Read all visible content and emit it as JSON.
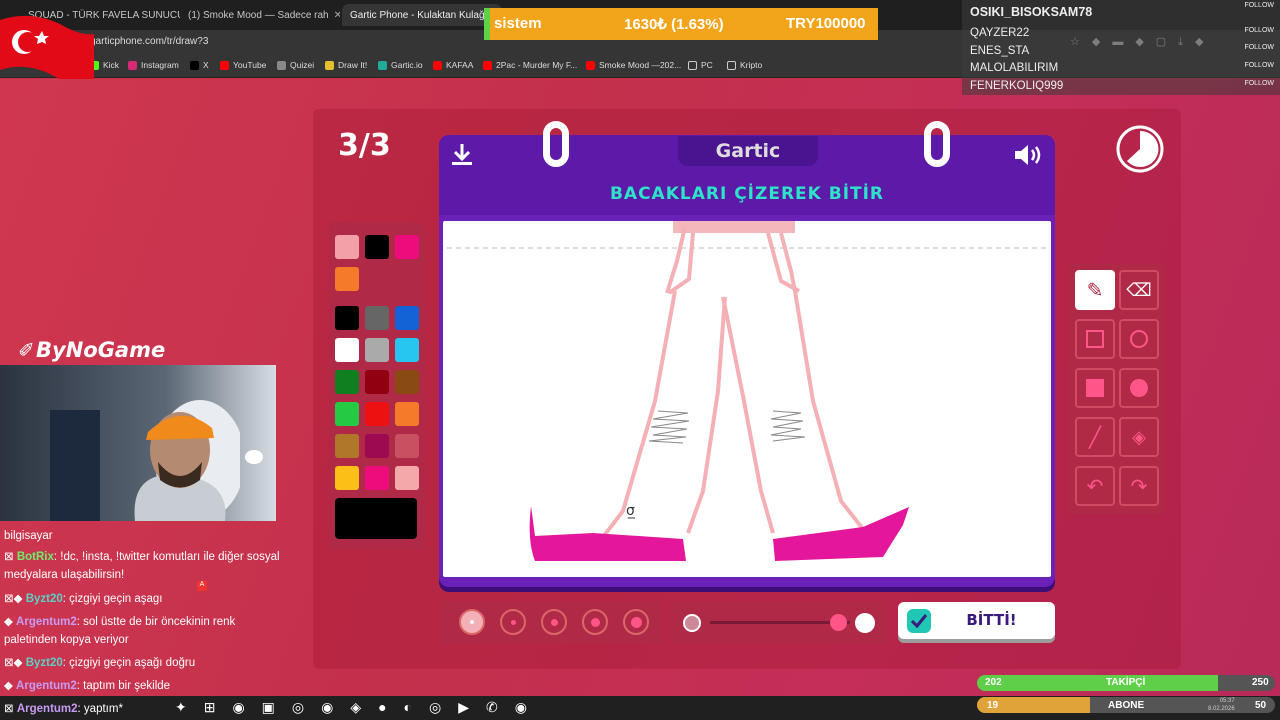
{
  "browser": {
    "tabs": [
      {
        "label": "SQUAD - TÜRK FAVELA SUNUCU"
      },
      {
        "label": "(1) Smoke Mood — Sadece rah"
      },
      {
        "label": "Gartic Phone - Kulaktan Kulağa"
      }
    ],
    "url": "garticphone.com/tr/draw?3",
    "bookmarks": [
      "Kick",
      "Instagram",
      "X",
      "YouTube",
      "Quizei",
      "Draw It!",
      "Gartic.io",
      "KAFAA",
      "2Pac - Murder My F...",
      "Smoke Mood —202...",
      "PC",
      "Kripto"
    ]
  },
  "game": {
    "round": "3/3",
    "logo": "Gartic",
    "instruction": "BACAKLARI ÇİZEREK BİTİR",
    "done_label": "BİTTİ!",
    "palette_top": [
      "#f4a0a8",
      "#000000",
      "#ec0c7c",
      "#f57a2a"
    ],
    "palette_grid": [
      "#000000",
      "#666666",
      "#1463d6",
      "#ffffff",
      "#aaaaaa",
      "#27c6f0",
      "#0f7f1f",
      "#900010",
      "#8a4a14",
      "#26c944",
      "#ee1111",
      "#f57a2a",
      "#b0762a",
      "#9e0a52",
      "#c85060",
      "#fbbf18",
      "#ec0c7c",
      "#f4a8aa"
    ],
    "current_color": "#000000"
  },
  "stream": {
    "ticker": {
      "name": "sistem",
      "amount": "1630₺ (1.63%)",
      "goal": "TRY100000"
    },
    "followers": [
      "OSIKI_BISOKSAM78",
      "QAYZER22",
      "ENES_STA",
      "MALOLABILIRIM",
      "FENERKOLIQ999"
    ],
    "follow_label": "FOLLOW",
    "channel": "ByNoGame",
    "chat": [
      {
        "user": "",
        "text": "bilgisayar"
      },
      {
        "user": "BotRix",
        "text": ": !dc, !insta, !twitter komutları ile diğer sosyal medyalara ulaşabilirsin!"
      },
      {
        "user": "Byzt20",
        "text": ": çizgiyi geçin aşagı"
      },
      {
        "user": "Argentum2",
        "text": ": sol üstte de bir öncekinin renk paletinden kopya veriyor"
      },
      {
        "user": "Byzt20",
        "text": ": çizgiyi geçin aşağı doğru"
      },
      {
        "user": "Argentum2",
        "text": ": taptım bir şekilde"
      },
      {
        "user": "Argentum2",
        "text": ": yaptım*"
      }
    ],
    "takipci": {
      "label": "TAKİPÇİ",
      "current": "202",
      "goal": "250",
      "progress": 0.81
    },
    "abone": {
      "label": "ABONE",
      "current": "19",
      "goal": "50",
      "progress": 0.38
    },
    "clock": {
      "time": "05:37",
      "date": "8.02.2026"
    }
  }
}
